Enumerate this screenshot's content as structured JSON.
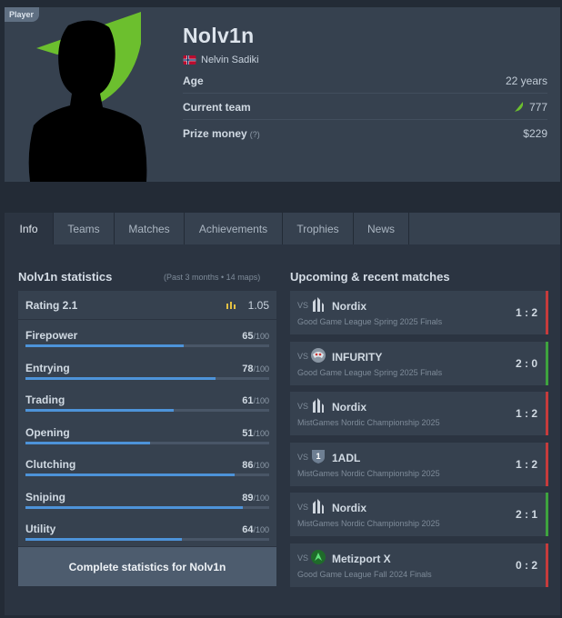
{
  "profile": {
    "tag": "Player",
    "nickname": "Nolv1n",
    "real_name": "Nelvin Sadiki",
    "flag_icon": "norway-flag-icon",
    "age_label": "Age",
    "age_value": "22 years",
    "team_label": "Current team",
    "team_value": "777",
    "team_logo_icon": "green-leaf-logo-icon",
    "prize_label": "Prize money",
    "prize_hint": "(?)",
    "prize_value": "$229"
  },
  "tabs": [
    "Info",
    "Teams",
    "Matches",
    "Achievements",
    "Trophies",
    "News"
  ],
  "stats": {
    "title": "Nolv1n statistics",
    "subtitle": "(Past 3 months • 14 maps)",
    "rating_label": "Rating 2.1",
    "rating_value": "1.05",
    "rating_icon": "bar-chart-icon",
    "max_suffix": "/100",
    "items": [
      {
        "label": "Firepower",
        "value": 65
      },
      {
        "label": "Entrying",
        "value": 78
      },
      {
        "label": "Trading",
        "value": 61
      },
      {
        "label": "Opening",
        "value": 51
      },
      {
        "label": "Clutching",
        "value": 86
      },
      {
        "label": "Sniping",
        "value": 89
      },
      {
        "label": "Utility",
        "value": 64
      }
    ],
    "complete_label": "Complete statistics for Nolv1n",
    "bar_color": "#4d93d9"
  },
  "matches": {
    "title": "Upcoming & recent matches",
    "vs_label": "VS",
    "win_color": "#3ea33e",
    "loss_color": "#c63b3b",
    "items": [
      {
        "team": "Nordix",
        "event": "Good Game League Spring 2025 Finals",
        "score": "1 : 2",
        "result": "loss",
        "logo": "nordix-logo-icon"
      },
      {
        "team": "INFURITY",
        "event": "Good Game League Spring 2025 Finals",
        "score": "2 : 0",
        "result": "win",
        "logo": "infurity-logo-icon"
      },
      {
        "team": "Nordix",
        "event": "MistGames Nordic Championship 2025",
        "score": "1 : 2",
        "result": "loss",
        "logo": "nordix-logo-icon"
      },
      {
        "team": "1ADL",
        "event": "MistGames Nordic Championship 2025",
        "score": "1 : 2",
        "result": "loss",
        "logo": "1adl-logo-icon"
      },
      {
        "team": "Nordix",
        "event": "MistGames Nordic Championship 2025",
        "score": "2 : 1",
        "result": "win",
        "logo": "nordix-logo-icon"
      },
      {
        "team": "Metizport X",
        "event": "Good Game League Fall 2024 Finals",
        "score": "0 : 2",
        "result": "loss",
        "logo": "metizport-logo-icon"
      }
    ]
  }
}
